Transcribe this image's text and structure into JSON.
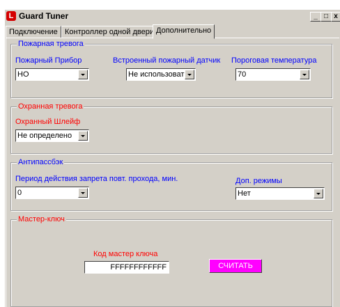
{
  "window": {
    "title": "Guard Tuner",
    "app_icon_glyph": "L",
    "controls": {
      "minimize": "_",
      "maximize": "□",
      "close": "x"
    }
  },
  "tabs": [
    {
      "label": "Подключение",
      "active": false
    },
    {
      "label": "Контроллер одной двери",
      "active": false
    },
    {
      "label": "Дополнительно",
      "active": true
    }
  ],
  "fire_alarm": {
    "legend": "Пожарная тревога",
    "device_label": "Пожарный Прибор",
    "device_value": "НО",
    "builtin_sensor_label": "Встроенный пожарный датчик",
    "builtin_sensor_value": "Не использовать",
    "threshold_label": "Пороговая температура",
    "threshold_value": "70"
  },
  "security_alarm": {
    "legend": "Охранная тревога",
    "loop_label": "Охранный Шлейф",
    "loop_value": "Не определено"
  },
  "antipassback": {
    "legend": "Антипассбэк",
    "period_label": "Период действия запрета повт. прохода, мин.",
    "period_value": "0",
    "modes_label": "Доп. режимы",
    "modes_value": "Нет"
  },
  "master_key": {
    "legend": "Мастер-ключ",
    "code_label": "Код мастер ключа",
    "code_value": "FFFFFFFFFFFF",
    "read_button": "СЧИТАТЬ"
  },
  "colors": {
    "face": "#d4d0c8",
    "blue_text": "#0000ff",
    "red_text": "#ff0000",
    "read_button": "#ff00ff"
  }
}
